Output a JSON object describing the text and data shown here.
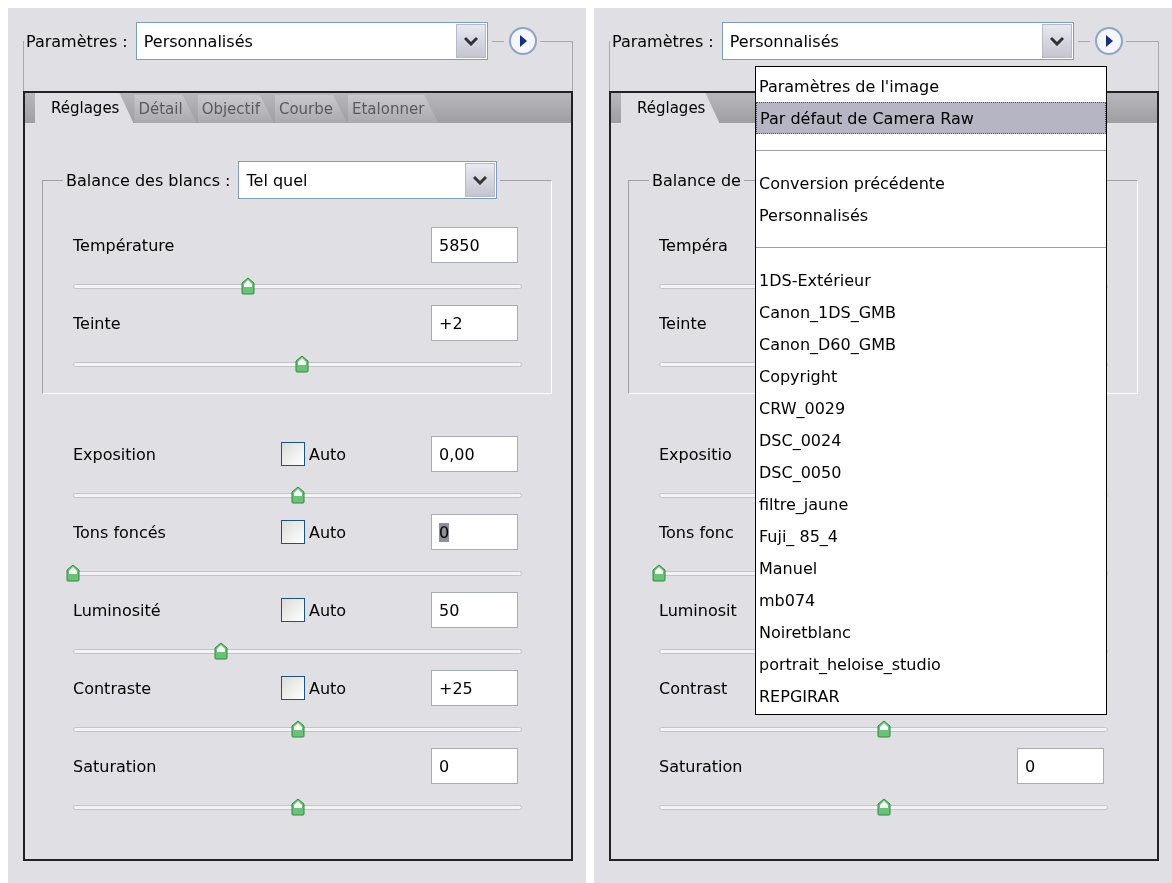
{
  "panels": [
    {
      "preset": {
        "label": "Paramètres :",
        "value": "Personnalisés"
      },
      "tabs": [
        {
          "label": "Réglages",
          "selected": true
        },
        {
          "label": "Détail",
          "selected": false
        },
        {
          "label": "Objectif",
          "selected": false
        },
        {
          "label": "Courbe",
          "selected": false
        },
        {
          "label": "Etalonner",
          "selected": false
        }
      ],
      "white_balance": {
        "label": "Balance des blancs :",
        "value": "Tel quel"
      },
      "wb_sliders": [
        {
          "label": "Température",
          "value": "5850",
          "value_highlighted": false,
          "level": 0.39
        },
        {
          "label": "Teinte",
          "value": "+2",
          "value_highlighted": false,
          "level": 0.51
        }
      ],
      "sliders": [
        {
          "label": "Exposition",
          "auto": {
            "label": "Auto",
            "checked": false
          },
          "value": "0,00",
          "value_highlighted": false,
          "level": 0.5
        },
        {
          "label": "Tons foncés",
          "auto": {
            "label": "Auto",
            "checked": false
          },
          "value": "0",
          "value_highlighted": true,
          "level": 0
        },
        {
          "label": "Luminosité",
          "auto": {
            "label": "Auto",
            "checked": false
          },
          "value": "50",
          "value_highlighted": false,
          "level": 0.33
        },
        {
          "label": "Contraste",
          "auto": {
            "label": "Auto",
            "checked": false
          },
          "value": "+25",
          "value_highlighted": false,
          "level": 0.5
        },
        {
          "label": "Saturation",
          "value": "0",
          "value_highlighted": false,
          "level": 0.5
        }
      ]
    },
    {
      "preset": {
        "label": "Paramètres :",
        "value": "Personnalisés"
      },
      "tabs": [
        {
          "label": "Réglages",
          "selected": true
        }
      ],
      "white_balance": {
        "label": "Balance de"
      },
      "wb_sliders": [
        {
          "label": "Tempéra"
        },
        {
          "label": "Teinte"
        }
      ],
      "sliders": [
        {
          "label": "Expositio"
        },
        {
          "label": "Tons fonc",
          "level": 0
        },
        {
          "label": "Luminosit"
        },
        {
          "label": "Contrast",
          "level": 0.5
        },
        {
          "label": "Saturation",
          "value": "0",
          "value_highlighted": false,
          "level": 0.5
        }
      ],
      "dropdown": {
        "items": [
          {
            "kind": "item",
            "label": "Paramètres de l'image",
            "selected": false
          },
          {
            "kind": "item",
            "label": "Par défaut de Camera Raw",
            "selected": true
          },
          {
            "kind": "separator"
          },
          {
            "kind": "item",
            "label": "Conversion précédente",
            "selected": false
          },
          {
            "kind": "item",
            "label": "Personnalisés",
            "selected": false
          },
          {
            "kind": "separator"
          },
          {
            "kind": "item",
            "label": "1DS-Extérieur",
            "selected": false
          },
          {
            "kind": "item",
            "label": "Canon_1DS_GMB",
            "selected": false
          },
          {
            "kind": "item",
            "label": "Canon_D60_GMB",
            "selected": false
          },
          {
            "kind": "item",
            "label": "Copyright",
            "selected": false
          },
          {
            "kind": "item",
            "label": "CRW_0029",
            "selected": false
          },
          {
            "kind": "item",
            "label": "DSC_0024",
            "selected": false
          },
          {
            "kind": "item",
            "label": "DSC_0050",
            "selected": false
          },
          {
            "kind": "item",
            "label": "filtre_jaune",
            "selected": false
          },
          {
            "kind": "item",
            "label": "Fuji_ 85_4",
            "selected": false
          },
          {
            "kind": "item",
            "label": "Manuel",
            "selected": false
          },
          {
            "kind": "item",
            "label": "mb074",
            "selected": false
          },
          {
            "kind": "item",
            "label": "Noiretblanc",
            "selected": false
          },
          {
            "kind": "item",
            "label": "portrait_heloise_studio",
            "selected": false
          },
          {
            "kind": "item",
            "label": "REPGIRAR",
            "selected": false
          }
        ]
      }
    }
  ]
}
